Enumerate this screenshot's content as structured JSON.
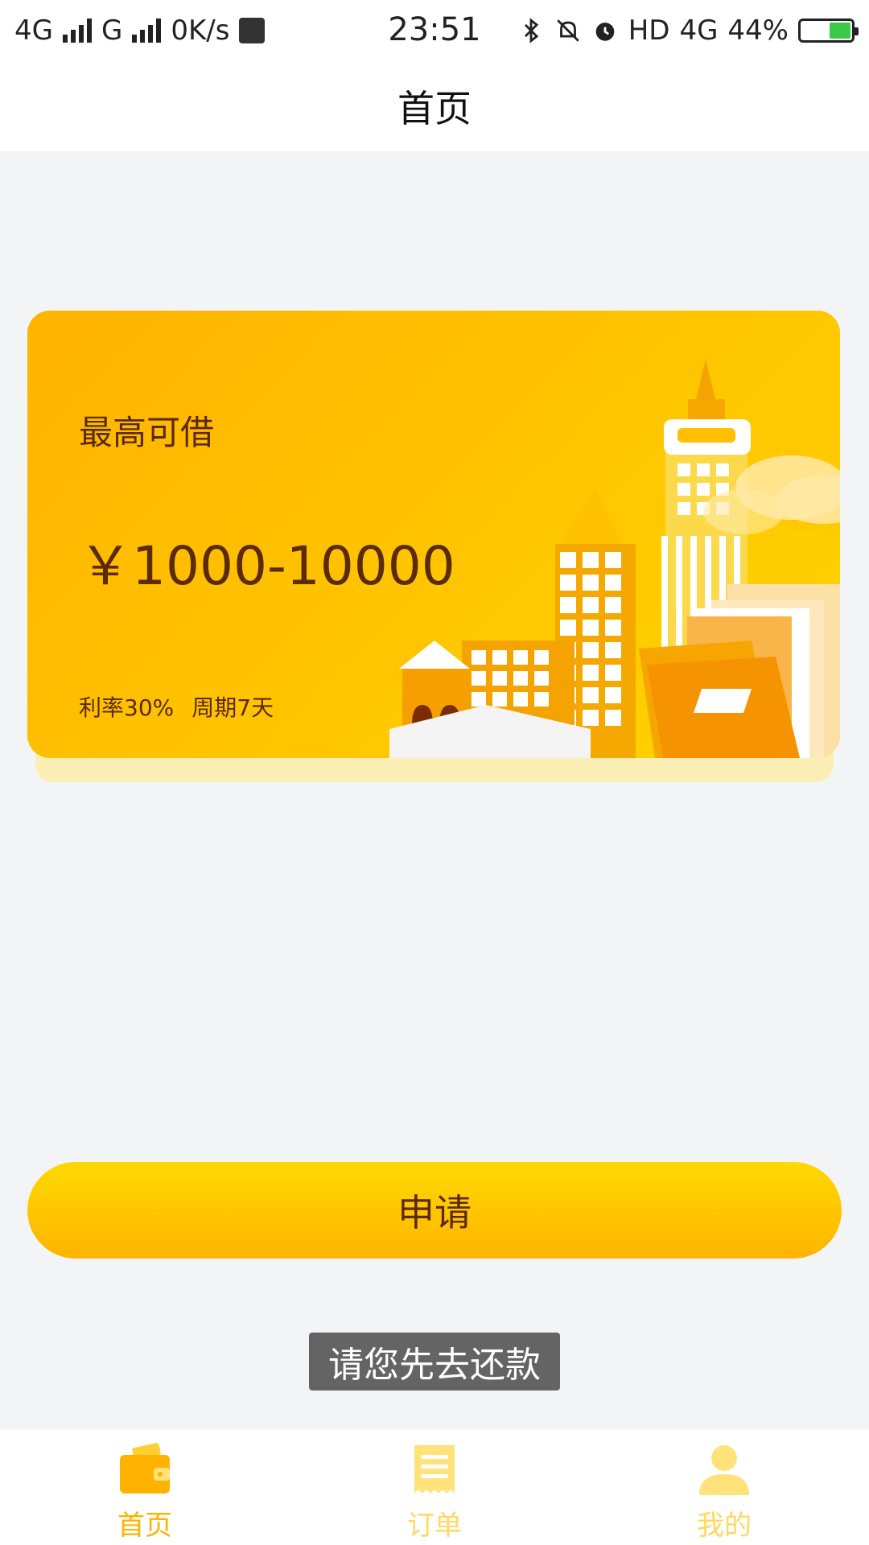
{
  "status_bar": {
    "network_1": "4G",
    "network_2": "G",
    "speed": "0K/s",
    "time": "23:51",
    "hd": "HD",
    "network_3": "4G",
    "battery_percent": "44%",
    "battery_level": 0.44,
    "icons": [
      "signal-icon",
      "app-notification-icon",
      "bluetooth-icon",
      "silent-icon",
      "alarm-icon",
      "battery-icon"
    ]
  },
  "header": {
    "title": "首页"
  },
  "loan_card": {
    "label": "最高可借",
    "amount": "￥1000-10000",
    "rate": "利率30%",
    "period": "周期7天",
    "colors": {
      "gradient_start": "#ffb300",
      "gradient_end": "#ffd400",
      "text": "#5b2a06"
    }
  },
  "apply_button": {
    "label": "申请"
  },
  "toast": {
    "message": "请您先去还款"
  },
  "bottom_nav": {
    "items": [
      {
        "label": "首页",
        "icon": "wallet-icon",
        "active": true
      },
      {
        "label": "订单",
        "icon": "receipt-icon",
        "active": false
      },
      {
        "label": "我的",
        "icon": "user-icon",
        "active": false
      }
    ],
    "active_color": "#ffb300",
    "inactive_color": "#ffd85e"
  }
}
